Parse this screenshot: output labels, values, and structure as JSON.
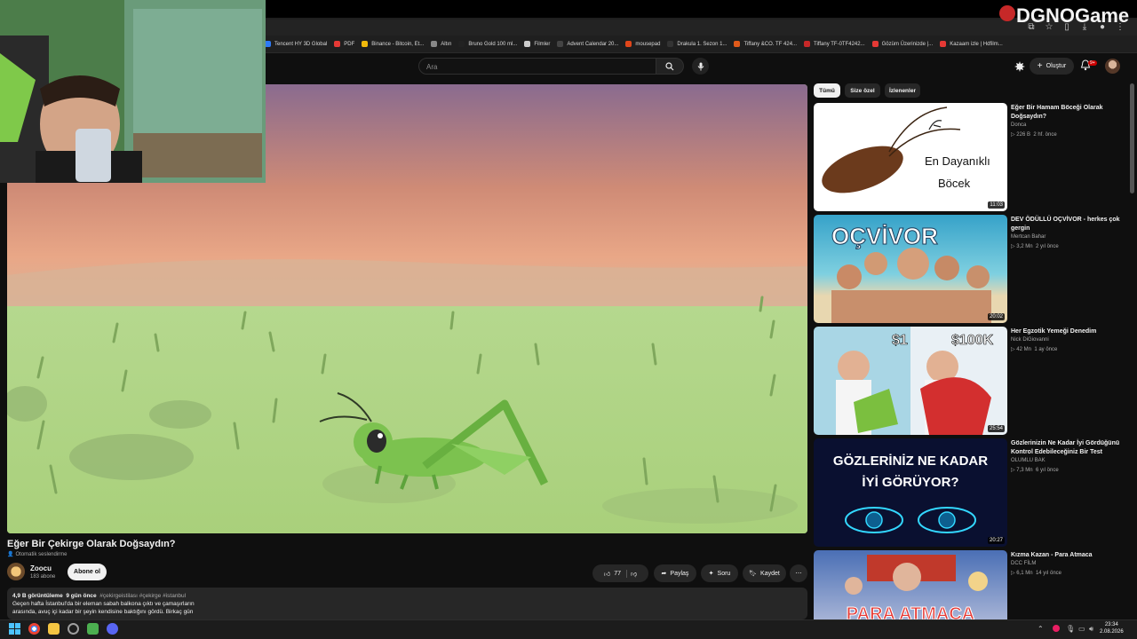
{
  "browser": {
    "bookmarks": [
      {
        "label": "Tencent HY 3D Global",
        "color": "#2f7bf6"
      },
      {
        "label": "PDF",
        "color": "#e53935"
      },
      {
        "label": "Binance - Bitcoin, Et...",
        "color": "#f0b90b"
      },
      {
        "label": "Altın",
        "color": "#888888"
      },
      {
        "label": "Bruno Gold 100 ml...",
        "color": "#222222"
      },
      {
        "label": "Filmler",
        "color": "#cccccc"
      },
      {
        "label": "Advent Calendar 20...",
        "color": "#444444"
      },
      {
        "label": "mousepad",
        "color": "#e0461a"
      },
      {
        "label": "Drakula 1. Sezon 1...",
        "color": "#333333"
      },
      {
        "label": "Tiffany &CO. TF 424...",
        "color": "#e05a1a"
      },
      {
        "label": "Tiffany TF-0TF4242...",
        "color": "#c62828"
      },
      {
        "label": "Gözüm Üzerinizde |...",
        "color": "#e53935"
      },
      {
        "label": "Kazaam izle | Hdfilm...",
        "color": "#e53935"
      }
    ]
  },
  "header": {
    "search_placeholder": "Ara",
    "create_label": "Oluştur",
    "notification_count": "9+"
  },
  "video": {
    "title": "Eğer Bir Çekirge Olarak Doğsaydın?",
    "auto_dub": "Otomatik seslendirme",
    "channel_name": "Zoocu",
    "channel_subs": "183 abone",
    "subscribe_label": "Abone ol",
    "like_count": "77",
    "share_label": "Paylaş",
    "ask_label": "Soru",
    "save_label": "Kaydet",
    "views": "4,9 B görüntüleme",
    "age": "9 gün önce",
    "tags": "#çekirgeistilası #çekirge #istanbul",
    "desc_line1": "Geçen hafta İstanbul'da bir eleman sabah balkona çıktı ve çamaşırların",
    "desc_line2": "arasında, avuç içi kadar bir şeyin kendisine baktığını gördü. Birkaç gün"
  },
  "chips": [
    {
      "label": "Tümü",
      "active": true
    },
    {
      "label": "Size özel",
      "active": false
    },
    {
      "label": "İzlenenler",
      "active": false
    }
  ],
  "recommendations": [
    {
      "title": "Eğer Bir Hamam Böceği Olarak Doğsaydın?",
      "channel": "Donca",
      "views": "226 B",
      "age": "2 hf. önce",
      "duration": "11:03",
      "thumb_text1": "En Dayanıklı",
      "thumb_text2": "Böcek"
    },
    {
      "title": "DEV ÖDÜLLÜ OÇVİVOR - herkes çok gergin",
      "channel": "Mertcan Bahar",
      "views": "3,2 Mn",
      "age": "2 yıl önce",
      "duration": "20:02",
      "thumb_text1": "OÇVİVOR"
    },
    {
      "title": "Her Egzotik Yemeği Denedim",
      "channel": "Nick DiGiovanni",
      "views": "42 Mn",
      "age": "1 ay önce",
      "duration": "25:54",
      "thumb_text1": "$1",
      "thumb_text2": "$100K"
    },
    {
      "title": "Gözlerinizin Ne Kadar İyi Gördüğünü Kontrol Edebileceğiniz Bir Test",
      "channel": "OLUMLU BAK",
      "views": "7,3 Mn",
      "age": "6 yıl önce",
      "duration": "20:27",
      "thumb_text1": "GÖZLERİNİZ NE KADAR",
      "thumb_text2": "İYİ GÖRÜYOR?"
    },
    {
      "title": "Kızma Kazan - Para Atmaca",
      "channel": "DCC FİLM",
      "views": "6,1 Mn",
      "age": "14 yıl önce",
      "duration": "",
      "thumb_text1": "PARA ATMACA"
    }
  ],
  "taskbar": {
    "time": "23:34",
    "date": "2.08.2026"
  },
  "watermark": "DGNOGame"
}
